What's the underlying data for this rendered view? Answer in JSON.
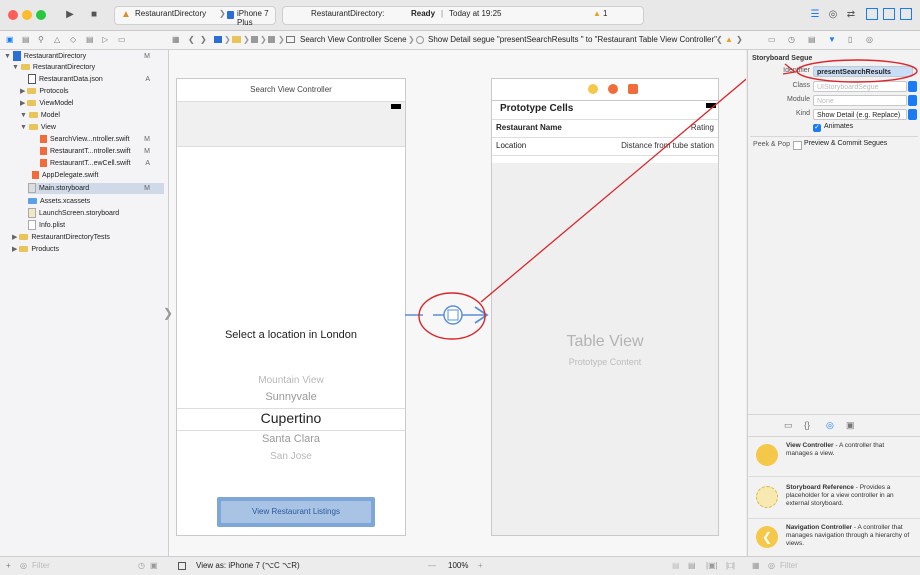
{
  "titlebar": {
    "scheme": "RestaurantDirectory",
    "device": "iPhone 7 Plus",
    "status_app": "RestaurantDirectory:",
    "status_state": "Ready",
    "status_time": "Today at 19:25",
    "warnings": "1"
  },
  "jumpbar": {
    "crumb_scene": "Search View Controller Scene",
    "crumb_segue": "Show Detail segue \"presentSearchResults \" to \"Restaurant Table View Controller\""
  },
  "navigator": {
    "items": [
      {
        "label": "RestaurantDirectory",
        "status": "M",
        "kind": "project"
      },
      {
        "label": "RestaurantDirectory",
        "status": "",
        "kind": "folder"
      },
      {
        "label": "RestaurantData.json",
        "status": "A",
        "kind": "file"
      },
      {
        "label": "Protocols",
        "status": "",
        "kind": "folder"
      },
      {
        "label": "ViewModel",
        "status": "",
        "kind": "folder"
      },
      {
        "label": "Model",
        "status": "",
        "kind": "folder"
      },
      {
        "label": "View",
        "status": "",
        "kind": "folder"
      },
      {
        "label": "SearchView...ntroller.swift",
        "status": "M",
        "kind": "swift"
      },
      {
        "label": "RestaurantT...ntroller.swift",
        "status": "M",
        "kind": "swift"
      },
      {
        "label": "RestaurantT...ewCell.swift",
        "status": "A",
        "kind": "swift"
      },
      {
        "label": "AppDelegate.swift",
        "status": "",
        "kind": "swift"
      },
      {
        "label": "Main.storyboard",
        "status": "M",
        "kind": "file"
      },
      {
        "label": "Assets.xcassets",
        "status": "",
        "kind": "folder"
      },
      {
        "label": "LaunchScreen.storyboard",
        "status": "",
        "kind": "file"
      },
      {
        "label": "Info.plist",
        "status": "",
        "kind": "file"
      },
      {
        "label": "RestaurantDirectoryTests",
        "status": "",
        "kind": "folder"
      },
      {
        "label": "Products",
        "status": "",
        "kind": "folder"
      }
    ],
    "filter_placeholder": "Filter"
  },
  "search_vc": {
    "title": "Search View Controller",
    "prompt": "Select a location in London",
    "picker": [
      "Mountain View",
      "Sunnyvale",
      "Cupertino",
      "Santa Clara",
      "San Jose"
    ],
    "button": "View Restaurant Listings"
  },
  "table_vc": {
    "prototype_cells": "Prototype Cells",
    "restaurant_name": "Restaurant Name",
    "rating": "Rating",
    "location": "Location",
    "distance": "Distance from tube station",
    "table_view": "Table View",
    "prototype_content": "Prototype Content"
  },
  "inspector": {
    "section": "Storyboard Segue",
    "identifier_label": "Identifier",
    "identifier_value": "presentSearchResults",
    "class_label": "Class",
    "class_placeholder": "UIStoryboardSegue",
    "module_label": "Module",
    "module_value": "None",
    "kind_label": "Kind",
    "kind_value": "Show Detail (e.g. Replace)",
    "animates_label": "Animates",
    "peek_label": "Peek & Pop",
    "peek_value": "Preview & Commit Segues"
  },
  "library": [
    {
      "title": "View Controller",
      "desc": " - A controller that manages a view.",
      "color": "#f5c84a"
    },
    {
      "title": "Storyboard Reference",
      "desc": " - Provides a placeholder for a view controller in an external storyboard.",
      "color": "#f7e9b0"
    },
    {
      "title": "Navigation Controller",
      "desc": " - A controller that manages navigation through a hierarchy of views.",
      "color": "#f5c84a"
    }
  ],
  "bottombar": {
    "view_as": "View as: iPhone 7 (⌥C ⌥R)",
    "zoom": "100%",
    "minus": "—",
    "plus": "+",
    "filter_placeholder": "Filter"
  },
  "colors": {
    "accent": "#1a7cf4",
    "annotation": "#d9262b",
    "highlight": "#cfd9e8"
  }
}
